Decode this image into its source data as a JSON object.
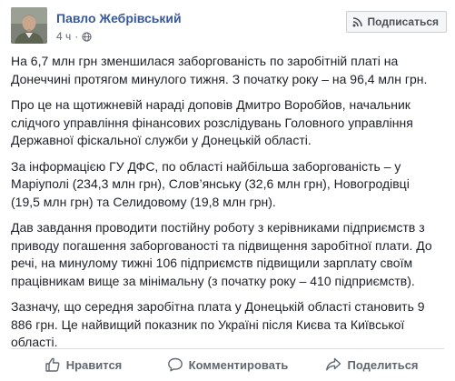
{
  "post": {
    "author": "Павло Жебрівський",
    "time": "4 ч",
    "dot": "·",
    "subscribe_label": "Подписаться",
    "paragraphs": [
      "На 6,7 млн грн зменшилася заборгованість по заробітній платі на Донеччині протягом минулого тижня. З початку року – на 96,4 млн грн.",
      "Про це на щотижневій нараді доповів Дмитро Воробйов, начальник слідчого управління фінансових розслідувань Головного управління Державної фіскальної служби у Донецькій області.",
      "За інформацією ГУ ДФС, по області найбільша заборгованість – у Маріуполі (234,3 млн грн), Слов’янську (32,6 млн грн), Новогродівці (19,5 млн грн) та Селидовому (19,8 млн грн).",
      "Дав завдання проводити постійну роботу з керівниками підприємств з приводу погашення заборгованості та підвищення заробітної плати. До речі, на минулому тижні 106 підприємств підвищили зарплату своїм працівникам вище за мінімальну (з початку року – 410 підприємств).",
      "Зазначу, що середня заробітна плата у Донецькій області становить 9 886 грн. Це найвищий показник по Україні після Києва та Київської області."
    ]
  },
  "actions": {
    "like": "Нравится",
    "comment": "Комментировать",
    "share": "Поделиться"
  },
  "colors": {
    "author": "#385898",
    "text": "#1d2129",
    "muted": "#606770"
  }
}
